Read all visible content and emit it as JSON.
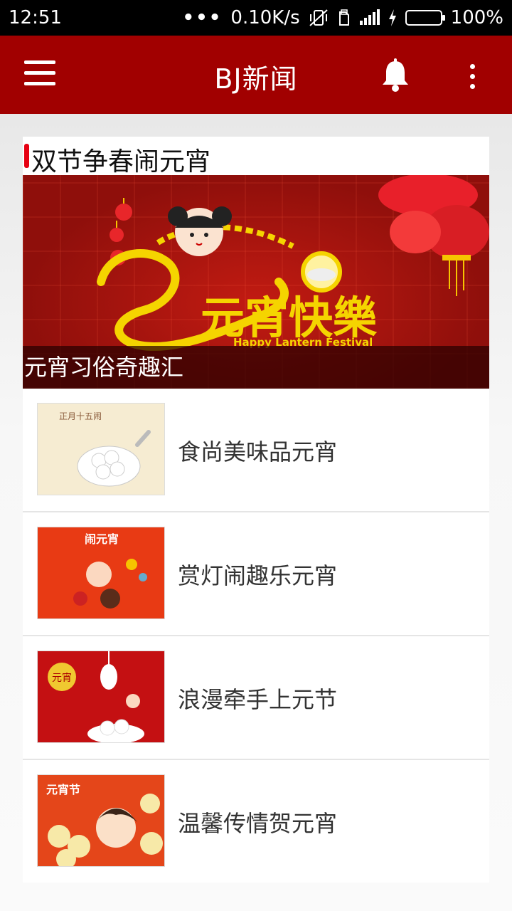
{
  "status_bar": {
    "time": "12:51",
    "dots": "•••",
    "speed": "0.10K/s",
    "battery": "100%",
    "battery_fill_fraction": 1.0
  },
  "app_bar": {
    "title": "BJ新闻",
    "menu_icon": "hamburger-menu-icon",
    "bell_icon": "bell-icon",
    "more_icon": "more-vertical-icon",
    "color": "#a10000"
  },
  "section": {
    "title": "双节争春闹元宵",
    "accent_color": "#e60012"
  },
  "banner": {
    "main_text": "元宵快樂",
    "sub_text": "Happy Lantern Festival",
    "caption": "元宵习俗奇趣汇"
  },
  "news": [
    {
      "title": "食尚美味品元宵",
      "thumb_text": "正月十五闹"
    },
    {
      "title": "赏灯闹趣乐元宵",
      "thumb_text": "闹元宵"
    },
    {
      "title": "浪漫牵手上元节",
      "thumb_text": "元宵"
    },
    {
      "title": "温馨传情贺元宵",
      "thumb_text": "元宵节"
    }
  ]
}
